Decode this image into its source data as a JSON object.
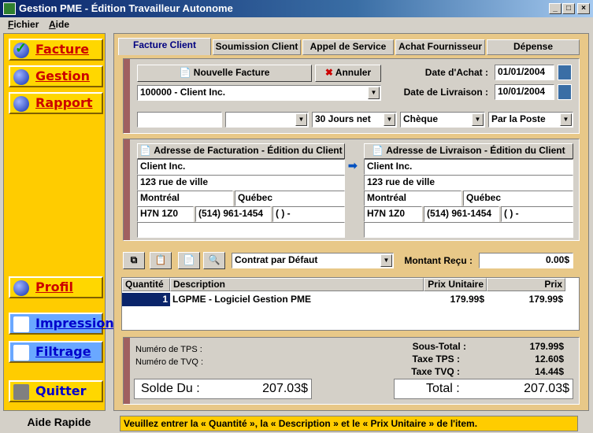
{
  "window": {
    "title": "Gestion PME - Édition Travailleur Autonome"
  },
  "menu": {
    "items": [
      "Fichier",
      "Aide"
    ]
  },
  "sidebar": {
    "facture": "Facture",
    "gestion": "Gestion",
    "rapport": "Rapport",
    "profil": "Profil",
    "impression": "Impression",
    "filtrage": "Filtrage",
    "quitter": "Quitter"
  },
  "tabs": [
    "Facture Client",
    "Soumission Client",
    "Appel de Service",
    "Achat Fournisseur",
    "Dépense"
  ],
  "header": {
    "nouvelle": "Nouvelle Facture",
    "annuler": "Annuler",
    "client": "100000 - Client Inc.",
    "date_achat_label": "Date d'Achat :",
    "date_achat": "01/01/2004",
    "date_livraison_label": "Date de Livraison :",
    "date_livraison": "10/01/2004",
    "terms": "30 Jours net",
    "payment": "Chèque",
    "shipping": "Par la Poste"
  },
  "billing": {
    "title": "Adresse de Facturation - Édition du Client",
    "name": "Client Inc.",
    "street": "123 rue de ville",
    "city": "Montréal",
    "province": "Québec",
    "postal": "H7N 1Z0",
    "phone": "(514) 961-1454",
    "fax": "(    )     -"
  },
  "shipping_addr": {
    "title": "Adresse de Livraison - Édition du Client",
    "name": "Client Inc.",
    "street": "123 rue de ville",
    "city": "Montréal",
    "province": "Québec",
    "postal": "H7N 1Z0",
    "phone": "(514) 961-1454",
    "fax": "(    )     -"
  },
  "contract": {
    "value": "Contrat par Défaut",
    "montant_label": "Montant Reçu :",
    "montant": "0.00$"
  },
  "grid": {
    "headers": [
      "Quantité",
      "Description",
      "Prix Unitaire",
      "Prix"
    ],
    "rows": [
      {
        "qty": "1",
        "desc": "LGPME - Logiciel Gestion PME",
        "unit": "179.99$",
        "price": "179.99$"
      }
    ]
  },
  "totals": {
    "tps_label": "Numéro de TPS :",
    "tvq_label": "Numéro de TVQ :",
    "sous_total_label": "Sous-Total :",
    "sous_total": "179.99$",
    "taxe_tps_label": "Taxe TPS :",
    "taxe_tps": "12.60$",
    "taxe_tvq_label": "Taxe TVQ :",
    "taxe_tvq": "14.44$",
    "solde_label": "Solde Du :",
    "solde": "207.03$",
    "total_label": "Total :",
    "total": "207.03$"
  },
  "status": {
    "aide": "Aide Rapide",
    "message": "Veuillez entrer la « Quantité », la « Description » et le « Prix Unitaire » de l'item."
  },
  "colors": {
    "sidebar": "#ffcc00",
    "main": "#e8c888",
    "accent": "#0a246a"
  }
}
